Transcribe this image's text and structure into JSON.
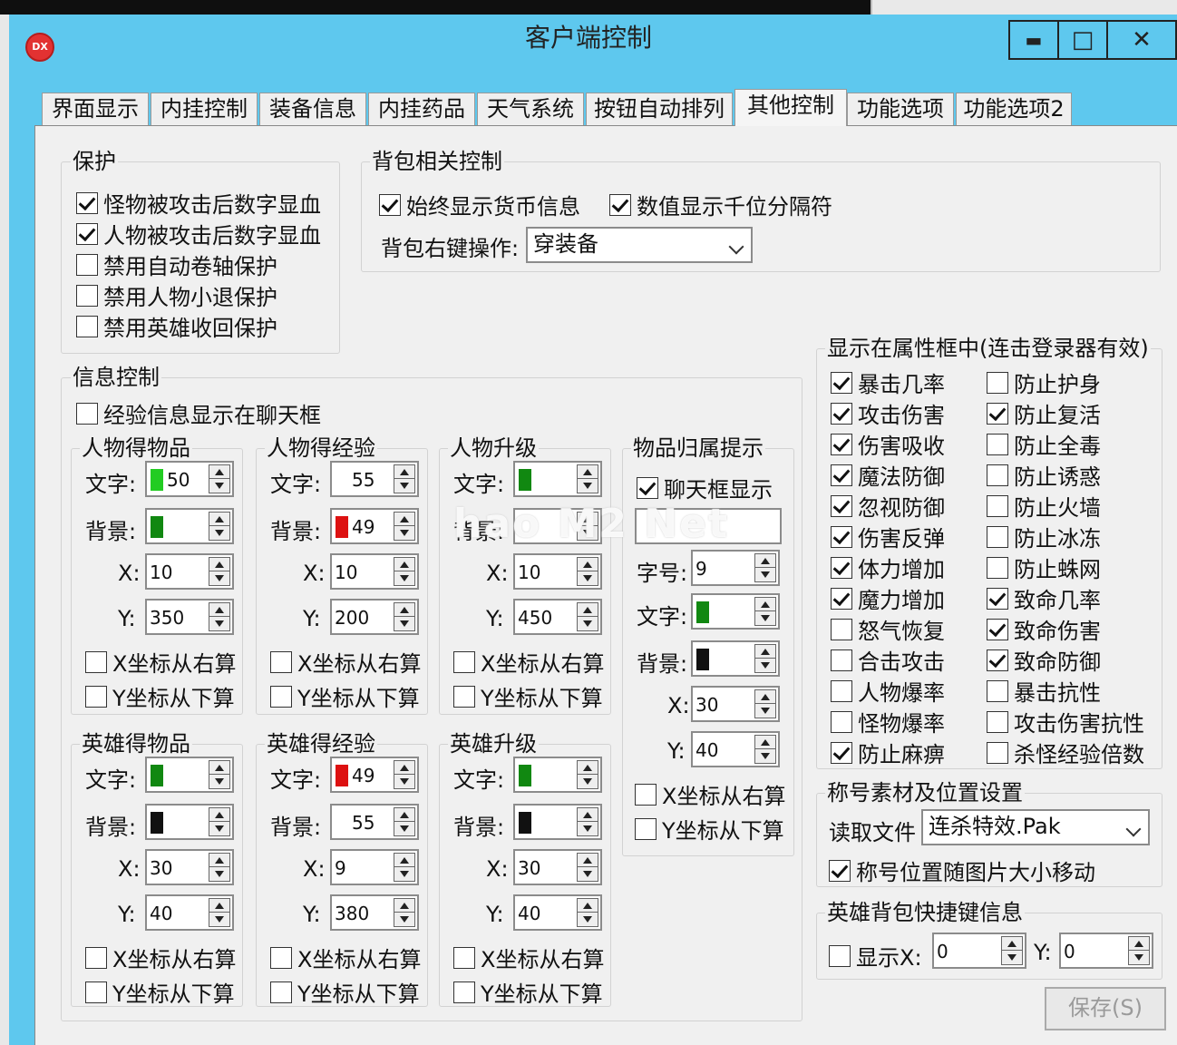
{
  "window": {
    "title": "客户端控制",
    "logo": "DX",
    "minimize": "▬",
    "maximize": "□",
    "close": "✕"
  },
  "tabs": [
    "界面显示",
    "内挂控制",
    "装备信息",
    "内挂药品",
    "天气系统",
    "按钮自动排列",
    "其他控制",
    "功能选项",
    "功能选项2"
  ],
  "protect": {
    "title": "保护",
    "items": [
      {
        "label": "怪物被攻击后数字显血",
        "checked": true
      },
      {
        "label": "人物被攻击后数字显血",
        "checked": true
      },
      {
        "label": "禁用自动卷轴保护",
        "checked": false
      },
      {
        "label": "禁用人物小退保护",
        "checked": false
      },
      {
        "label": "禁用英雄收回保护",
        "checked": false
      }
    ]
  },
  "bag": {
    "title": "背包相关控制",
    "items": [
      {
        "label": "始终显示货币信息",
        "checked": true
      },
      {
        "label": "数值显示千位分隔符",
        "checked": true
      }
    ],
    "rightclick_label": "背包右键操作:",
    "rightclick_value": "穿装备"
  },
  "info": {
    "title": "信息控制",
    "chat_exp": "经验信息显示在聊天框",
    "text_label": "文字:",
    "bg_label": "背景:",
    "x_label": "X:",
    "y_label": "Y:",
    "x_right": "X坐标从右算",
    "y_bottom": "Y坐标从下算",
    "groups": [
      {
        "title": "人物得物品",
        "text_val": "50",
        "text_color": "#22cc22",
        "bg_val": "",
        "bg_color": "#118811",
        "x": "10",
        "y": "350"
      },
      {
        "title": "人物得经验",
        "text_val": "55",
        "text_color": "#ffffff",
        "bg_val": "49",
        "bg_color": "#dd1111",
        "x": "10",
        "y": "200"
      },
      {
        "title": "人物升级",
        "text_val": "",
        "text_color": "#118811",
        "bg_val": "",
        "bg_color": "",
        "x": "10",
        "y": "450"
      },
      {
        "title": "英雄得物品",
        "text_val": "",
        "text_color": "#118811",
        "bg_val": "",
        "bg_color": "#111111",
        "x": "30",
        "y": "40"
      },
      {
        "title": "英雄得经验",
        "text_val": "49",
        "text_color": "#dd1111",
        "bg_val": "55",
        "bg_color": "#ffffff",
        "x": "9",
        "y": "380"
      },
      {
        "title": "英雄升级",
        "text_val": "",
        "text_color": "#118811",
        "bg_val": "",
        "bg_color": "#111111",
        "x": "30",
        "y": "40"
      }
    ]
  },
  "belong": {
    "title": "物品归属提示",
    "chat_show": "聊天框显示",
    "font_label": "字号:",
    "font_val": "9",
    "text_label": "文字:",
    "bg_label": "背景:",
    "x_label": "X:",
    "x": "30",
    "y_label": "Y:",
    "y": "40",
    "x_right": "X坐标从右算",
    "y_bottom": "Y坐标从下算"
  },
  "attr": {
    "title": "显示在属性框中(连击登录器有效)",
    "left": [
      {
        "label": "暴击几率",
        "checked": true
      },
      {
        "label": "攻击伤害",
        "checked": true
      },
      {
        "label": "伤害吸收",
        "checked": true
      },
      {
        "label": "魔法防御",
        "checked": true
      },
      {
        "label": "忽视防御",
        "checked": true
      },
      {
        "label": "伤害反弹",
        "checked": true
      },
      {
        "label": "体力增加",
        "checked": true
      },
      {
        "label": "魔力增加",
        "checked": true
      },
      {
        "label": "怒气恢复",
        "checked": false
      },
      {
        "label": "合击攻击",
        "checked": false
      },
      {
        "label": "人物爆率",
        "checked": false
      },
      {
        "label": "怪物爆率",
        "checked": false
      },
      {
        "label": "防止麻痹",
        "checked": true
      }
    ],
    "right": [
      {
        "label": "防止护身",
        "checked": false
      },
      {
        "label": "防止复活",
        "checked": true
      },
      {
        "label": "防止全毒",
        "checked": false
      },
      {
        "label": "防止诱惑",
        "checked": false
      },
      {
        "label": "防止火墙",
        "checked": false
      },
      {
        "label": "防止冰冻",
        "checked": false
      },
      {
        "label": "防止蛛网",
        "checked": false
      },
      {
        "label": "致命几率",
        "checked": true
      },
      {
        "label": "致命伤害",
        "checked": true
      },
      {
        "label": "致命防御",
        "checked": true
      },
      {
        "label": "暴击抗性",
        "checked": false
      },
      {
        "label": "攻击伤害抗性",
        "checked": false
      },
      {
        "label": "杀怪经验倍数",
        "checked": false
      }
    ]
  },
  "titlecfg": {
    "title": "称号素材及位置设置",
    "file_label": "读取文件",
    "file_value": "连杀特效.Pak",
    "move_label": "称号位置随图片大小移动",
    "move_checked": true
  },
  "herokey": {
    "title": "英雄背包快捷键信息",
    "show_label": "显示X:",
    "x": "0",
    "y_label": "Y:",
    "y": "0"
  },
  "save_label": "保存(S)",
  "watermark": "hao M2 Net"
}
